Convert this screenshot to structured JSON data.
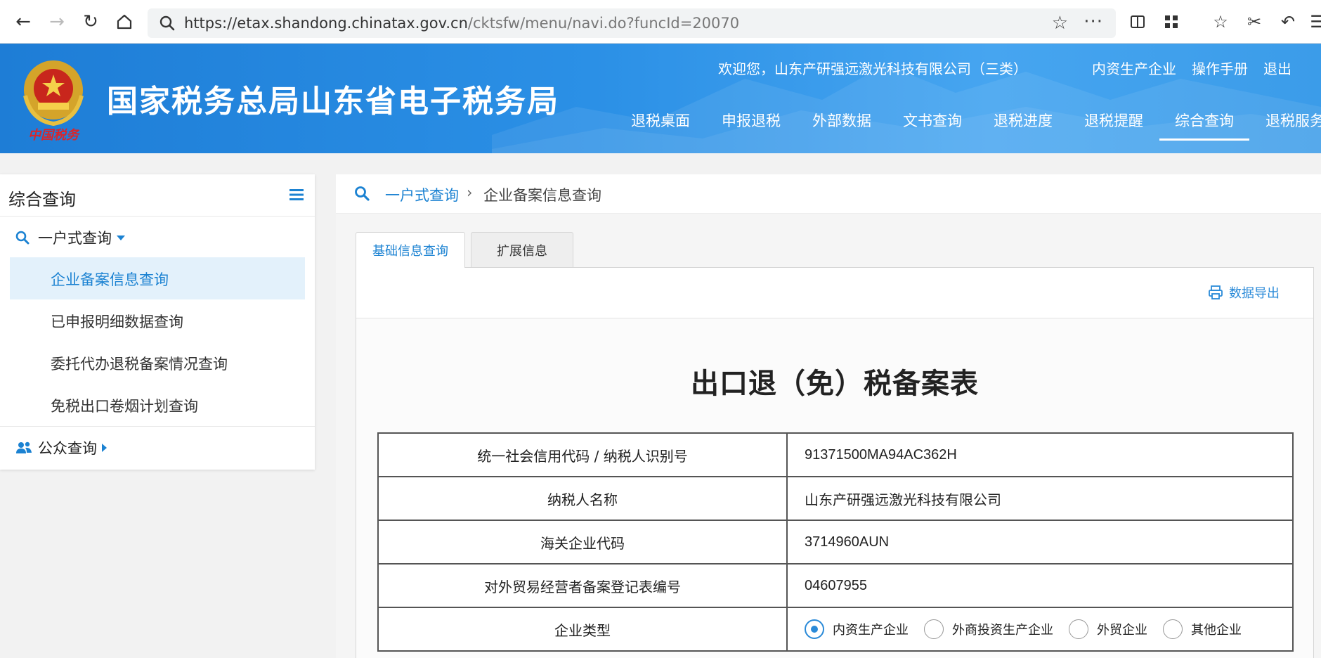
{
  "browser": {
    "url_host": "https://etax.shandong.chinatax.gov.cn",
    "url_path": "/cktsfw/menu/navi.do?funcId=20070"
  },
  "header": {
    "site_title": "国家税务总局山东省电子税务局",
    "emblem_text": "中国税务",
    "welcome": "欢迎您，山东产研强远激光科技有限公司（三类）",
    "links": [
      "内资生产企业",
      "操作手册",
      "退出"
    ],
    "nav": [
      "退税桌面",
      "申报退税",
      "外部数据",
      "文书查询",
      "退税进度",
      "退税提醒",
      "综合查询",
      "退税服务"
    ],
    "active_nav": "综合查询"
  },
  "sidebar": {
    "title": "综合查询",
    "group1": "一户式查询",
    "items": [
      "企业备案信息查询",
      "已申报明细数据查询",
      "委托代办退税备案情况查询",
      "免税出口卷烟计划查询"
    ],
    "group2": "公众查询"
  },
  "breadcrumb": {
    "parent": "一户式查询",
    "separator": "›",
    "current": "企业备案信息查询"
  },
  "tabs": [
    "基础信息查询",
    "扩展信息"
  ],
  "toolbar": {
    "export_label": "数据导出"
  },
  "document": {
    "title": "出口退（免）税备案表",
    "rows": [
      {
        "label": "统一社会信用代码 / 纳税人识别号",
        "value": "91371500MA94AC362H"
      },
      {
        "label": "纳税人名称",
        "value": "山东产研强远激光科技有限公司"
      },
      {
        "label": "海关企业代码",
        "value": "3714960AUN"
      },
      {
        "label": "对外贸易经营者备案登记表编号",
        "value": "04607955"
      }
    ],
    "enterprise_type_label": "企业类型",
    "enterprise_types": [
      "内资生产企业",
      "外商投资生产企业",
      "外贸企业",
      "其他企业"
    ],
    "enterprise_type_selected": "内资生产企业"
  },
  "colors": {
    "brand_blue": "#1b82d2",
    "header_blue": "#2b90e6"
  }
}
